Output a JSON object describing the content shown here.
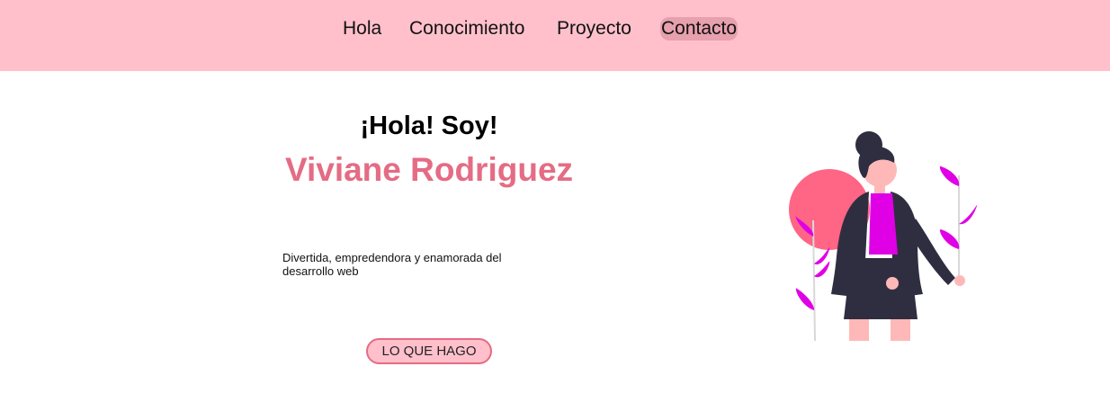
{
  "nav": {
    "items": [
      {
        "label": "Hola"
      },
      {
        "label": "Conocimiento"
      },
      {
        "label": "Proyecto"
      },
      {
        "label": "Contacto"
      }
    ],
    "active": "Contacto"
  },
  "hero": {
    "greeting": "¡Hola! Soy!",
    "name": "Viviane Rodriguez",
    "tagline": "Divertida, empredendora y enamorada del desarrollo web",
    "cta_label": "LO QUE HAGO"
  },
  "colors": {
    "navbar_bg": "#ffc0cb",
    "active_pill": "#e7a0ad",
    "accent": "#e46c84",
    "sun": "#ff6584",
    "leaf": "#e000e6",
    "dark": "#2f2e41",
    "skin": "#ffb8b8"
  }
}
